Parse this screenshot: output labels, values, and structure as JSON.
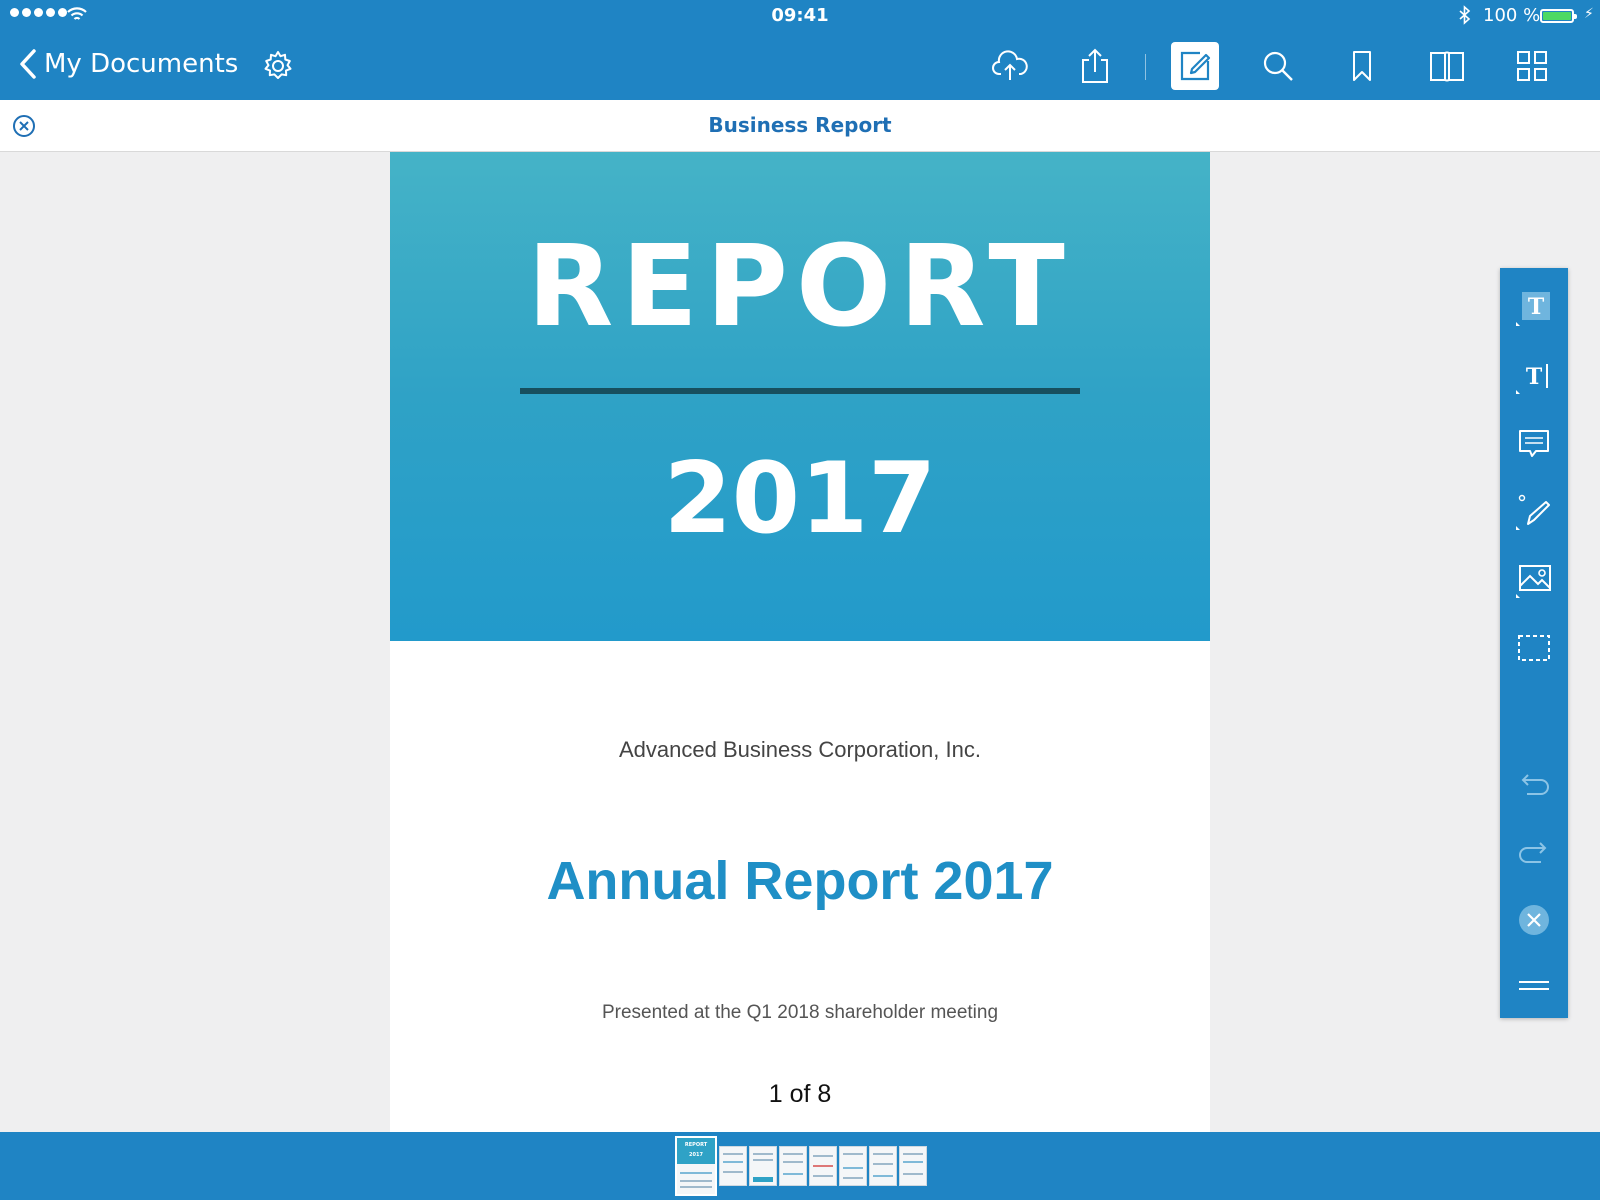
{
  "status_bar": {
    "time": "09:41",
    "battery_text": "100 %",
    "signal_dots": 5,
    "battery_level": 1.0
  },
  "nav": {
    "back_label": "My Documents",
    "icons": [
      "back-chevron-icon",
      "gear-icon",
      "cloud-upload-icon",
      "share-icon",
      "annotate-icon",
      "search-icon",
      "bookmark-icon",
      "book-icon",
      "grid-icon"
    ],
    "active": "annotate-icon"
  },
  "doc_bar": {
    "title": "Business Report"
  },
  "page": {
    "cover_title": "REPORT",
    "cover_year": "2017",
    "company": "Advanced Business Corporation, Inc.",
    "headline": "Annual Report 2017",
    "subtitle": "Presented at the Q1 2018 shareholder meeting",
    "page_indicator": "1 of 8"
  },
  "colors": {
    "bar_blue": "#1f84c4",
    "cover_teal": "#2fa2c6",
    "headline_blue": "#1f8fc6",
    "doc_title_blue": "#1f6fb4"
  },
  "tools": [
    "text-box-icon",
    "text-cursor-icon",
    "comment-icon",
    "pen-icon",
    "image-icon",
    "selection-icon",
    "undo-icon",
    "redo-icon",
    "close-circle-icon",
    "menu-icon"
  ],
  "thumbnails": {
    "count": 8,
    "current": 1,
    "thumb1_title": "REPORT",
    "thumb1_year": "2017"
  }
}
